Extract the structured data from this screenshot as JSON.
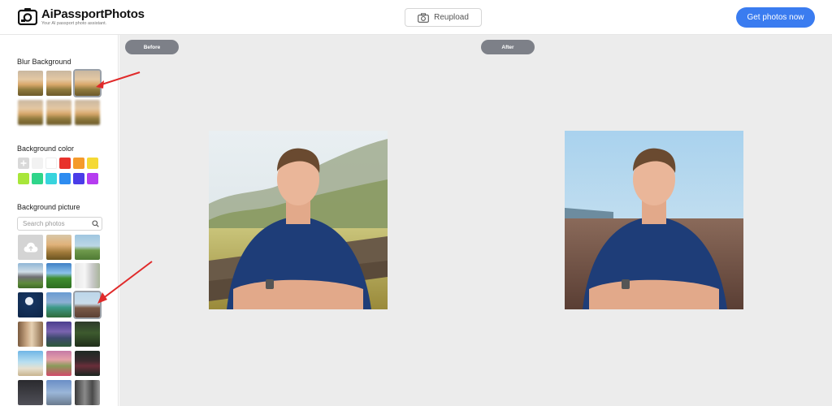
{
  "header": {
    "brand": "AiPassportPhotos",
    "tagline": "Your AI passport photo assistant.",
    "reupload_label": "Reupload",
    "cta_label": "Get photos now",
    "accent_color": "#3a7cf0"
  },
  "sidebar": {
    "blur_title": "Blur Background",
    "color_title": "Background color",
    "picture_title": "Background picture",
    "search_placeholder": "Search photos",
    "colors": [
      "#d9d9d9",
      "#f2f2f2",
      "#ffffff",
      "#e8322c",
      "#f59a2b",
      "#f5d935",
      "#a8e63a",
      "#2fd58a",
      "#38d4dd",
      "#2e8cf0",
      "#4a3ce8",
      "#b53cf0"
    ]
  },
  "main": {
    "before_label": "Before",
    "after_label": "After"
  },
  "icons": {
    "logo": "camera-logo-icon",
    "reupload": "camera-icon",
    "search": "search-icon",
    "upload": "cloud-upload-icon",
    "add_color": "plus-icon"
  }
}
